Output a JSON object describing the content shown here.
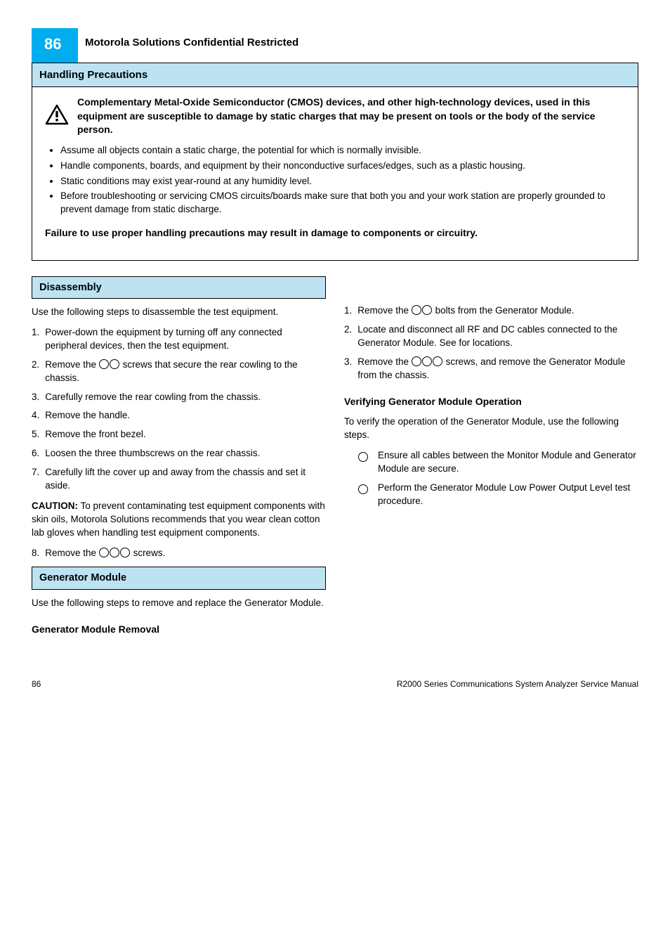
{
  "page_number": "86",
  "header_title": "Motorola Solutions Confidential Restricted",
  "safety": {
    "title": "Handling Precautions",
    "warning_head": "Complementary Metal-Oxide Semiconductor (CMOS) devices, and other high-technology devices, used in this equipment are susceptible to damage by static charges that may be present on tools or the body of the service person.",
    "bullets": [
      "Assume all objects contain a static charge, the potential for which is normally invisible.",
      "Handle components, boards, and equipment by their nonconductive surfaces/edges, such as a plastic housing.",
      "Static conditions may exist year-round at any humidity level.",
      "Before troubleshooting or servicing CMOS circuits/boards make sure that both you and your work station are properly grounded to prevent damage from static discharge."
    ],
    "note": "Failure to use proper handling precautions may result in damage to components or circuitry."
  },
  "disassembly": {
    "title": "Disassembly",
    "steps": {
      "intro": "Use the following steps to disassemble the test equipment.",
      "s1_num": "1.",
      "s1": "Power-down the equipment by turning off any connected peripheral devices, then the test equipment.",
      "s2_num": "2.",
      "s2_prefix": "Remove the ",
      "s2_suffix": " screws that secure the rear cowling to the chassis.",
      "s3_num": "3.",
      "s3": "Carefully remove the rear cowling from the chassis.",
      "s4_num": "4.",
      "s4": "Remove the handle.",
      "s5_num": "5.",
      "s5": "Remove the front bezel.",
      "s6_num": "6.",
      "s6": "Loosen the three thumbscrews on the rear chassis.",
      "s7_num": "7.",
      "s7": "Carefully lift the cover up and away from the chassis and set it aside.",
      "caution_label": "CAUTION:",
      "caution": "To prevent contaminating test equipment components with skin oils, Motorola Solutions recommends that you wear clean cotton lab gloves when handling test equipment components.",
      "s8_num": "8.",
      "s8_prefix": "Remove the ",
      "s8_suffix": " screws."
    }
  },
  "generator": {
    "title": "Generator Module",
    "intro": "Use the following steps to remove and replace the Generator Module.",
    "sec1_title": "Generator Module Removal",
    "sec2_title": "Verifying Generator Module Operation",
    "remove": {
      "s1_num": "1.",
      "s1_prefix": "Remove the ",
      "s1_suffix": " bolts from the Generator Module.",
      "s2_num": "2.",
      "s2": "Locate and disconnect all RF and DC cables connected to the Generator Module. See for locations.",
      "s3_num": "3.",
      "s3_prefix": "Remove the ",
      "s3_suffix": " screws, and remove the Generator Module from the chassis."
    },
    "verify": {
      "intro": "To verify the operation of the Generator Module, use the following steps.",
      "v1": "Ensure all cables between the Monitor Module and Generator Module are secure.",
      "v2": "Perform the Generator Module Low Power Output Level test procedure."
    }
  },
  "footer": {
    "left": "86",
    "right": "R2000 Series Communications System Analyzer Service Manual"
  }
}
